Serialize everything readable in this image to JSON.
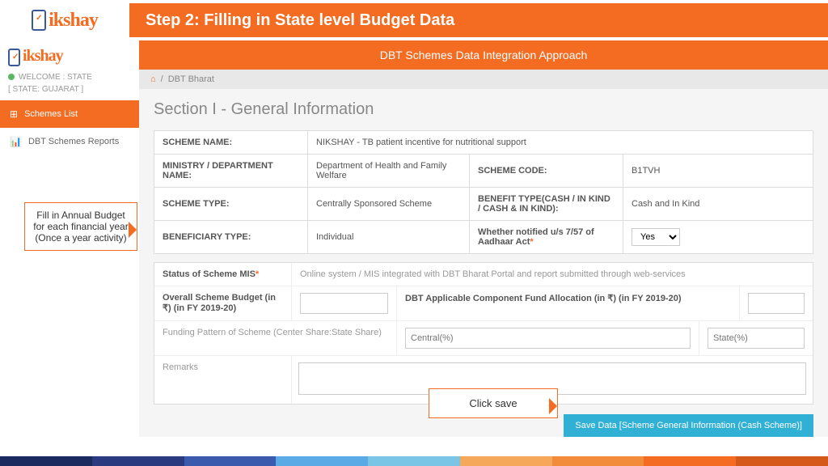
{
  "step_title": "Step 2: Filling in State level Budget Data",
  "logo_text": "ikshay",
  "welcome": "WELCOME : STATE",
  "state_label": "[ STATE: GUJARAT ]",
  "nav": {
    "schemes_list": "Schemes List",
    "dbt_reports": "DBT Schemes Reports"
  },
  "banner": "DBT Schemes Data Integration Approach",
  "breadcrumb": "DBT Bharat",
  "section_title": "Section I - General Information",
  "info": {
    "scheme_name_lbl": "SCHEME NAME:",
    "scheme_name_val": "NIKSHAY - TB patient incentive for nutritional support",
    "ministry_lbl": "MINISTRY / DEPARTMENT NAME:",
    "ministry_val": "Department of Health and Family Welfare",
    "scheme_code_lbl": "SCHEME CODE:",
    "scheme_code_val": "B1TVH",
    "scheme_type_lbl": "SCHEME TYPE:",
    "scheme_type_val": "Centrally Sponsored Scheme",
    "benefit_type_lbl": "BENEFIT TYPE(CASH / IN KIND / CASH & IN KIND):",
    "benefit_type_val": "Cash and In Kind",
    "beneficiary_lbl": "BENEFICIARY TYPE:",
    "beneficiary_val": "Individual",
    "aadhaar_lbl": "Whether notified u/s 7/57 of Aadhaar Act",
    "aadhaar_val": "Yes"
  },
  "form": {
    "status_lbl": "Status of Scheme MIS",
    "status_val": "Online system / MIS integrated with DBT Bharat Portal and report submitted through web-services",
    "budget_lbl": "Overall Scheme Budget (in ₹) (in FY 2019-20)",
    "dbt_comp_lbl": "DBT Applicable Component Fund Allocation (in ₹) (in FY 2019-20)",
    "funding_lbl": "Funding Pattern of Scheme (Center Share:State Share)",
    "central_ph": "Central(%)",
    "state_ph": "State(%)",
    "remarks_lbl": "Remarks",
    "save_btn": "Save Data [Scheme General Information (Cash Scheme)]"
  },
  "callout1": "Fill in Annual Budget for each financial year (Once a year activity)",
  "callout2": "Click save"
}
